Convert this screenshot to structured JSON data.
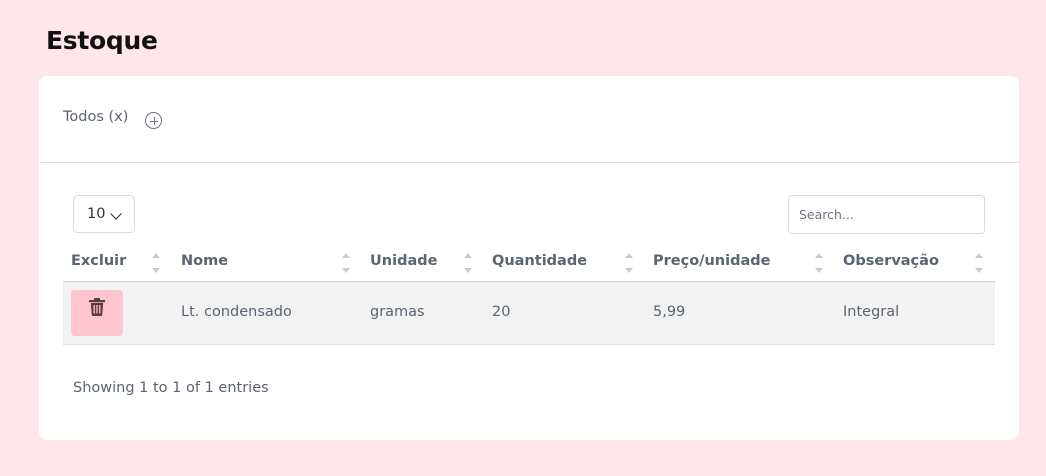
{
  "page": {
    "title": "Estoque"
  },
  "filters": {
    "todos_label": "Todos (x)",
    "add_icon": "plus-circle-icon"
  },
  "table_controls": {
    "length_value": "10",
    "search_placeholder": "Search...",
    "search_value": ""
  },
  "table": {
    "columns": [
      "Excluir",
      "Nome",
      "Unidade",
      "Quantidade",
      "Preço/unidade",
      "Observação"
    ],
    "rows": [
      {
        "delete_icon": "trash-icon",
        "nome": "Lt. condensado",
        "unidade": "gramas",
        "quantidade": "20",
        "preco": "5,99",
        "observacao": "Integral"
      }
    ]
  },
  "footer": {
    "info": "Showing 1 to 1 of 1 entries"
  },
  "colors": {
    "background": "#ffe6ea",
    "delete_button": "#ffc5d0",
    "row_background": "#f2f2f2"
  }
}
